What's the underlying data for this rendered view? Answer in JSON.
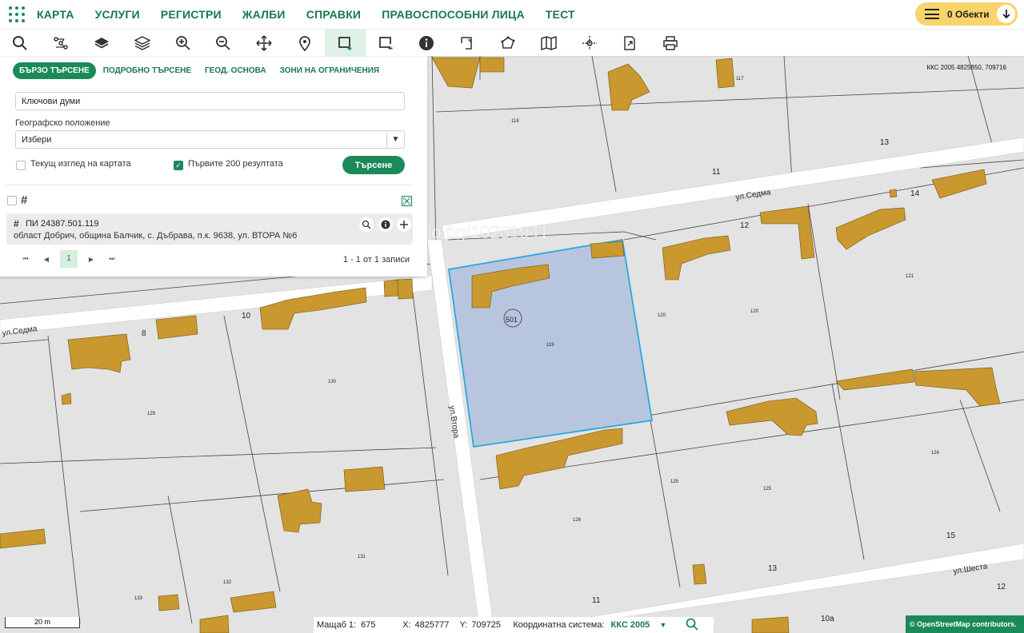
{
  "nav": {
    "items": [
      "КАРТА",
      "УСЛУГИ",
      "РЕГИСТРИ",
      "ЖАЛБИ",
      "СПРАВКИ",
      "ПРАВОСПОСОБНИ ЛИЦА",
      "ТЕСТ"
    ],
    "objects_label": "0 Обекти"
  },
  "toolbar": {
    "tools": [
      "search-icon",
      "route-icon",
      "layer-icon",
      "layers-icon",
      "zoom-in-icon",
      "zoom-out-icon",
      "pan-icon",
      "location-pin-icon",
      "select-rectangle-icon",
      "deselect-rectangle-icon",
      "info-icon",
      "measure-area-icon",
      "polygon-icon",
      "map-icon",
      "coordinate-icon",
      "export-icon",
      "print-icon"
    ],
    "active_index": 8
  },
  "panel": {
    "tabs": [
      "БЪРЗО ТЪРСЕНЕ",
      "ПОДРОБНО ТЪРСЕНЕ",
      "ГЕОД. ОСНОВА",
      "ЗОНИ НА ОГРАНИЧЕНИЯ"
    ],
    "keywords_placeholder": "Ключови думи",
    "geo_label": "Географско положение",
    "geo_value": "Избери",
    "current_view_label": "Текущ изглед на картата",
    "current_view_checked": false,
    "first200_label": "Първите 200 резултата",
    "first200_checked": true,
    "search_button": "Търсене",
    "result": {
      "title": "ПИ 24387.501.119",
      "address": "област Добрич, община Балчик, с. Дъбрава, п.к. 9638, ул. ВТОРА №6"
    },
    "pager": {
      "first": "⏮",
      "prev": "◀",
      "current": "1",
      "next": "▶",
      "last": "⏭"
    },
    "count": "1 - 1 от 1 записи"
  },
  "map": {
    "crs_readout": "ККС 2005 4825850, 709716",
    "watermark": "alo.bg/10231941",
    "streets": [
      "ул.Седма",
      "ул.Седма",
      "ул.Втора",
      "ул.Шеста"
    ],
    "numbers": [
      "13",
      "11",
      "14",
      "12",
      "10",
      "8",
      "13",
      "11",
      "15",
      "12",
      "10а"
    ],
    "parcels": [
      "118",
      "117",
      "119",
      "120",
      "120",
      "121",
      "130",
      "129",
      "125",
      "125",
      "124",
      "126",
      "131",
      "132",
      "133"
    ],
    "highlight_label": "501",
    "colors": {
      "building": "#c9982e",
      "highlight_fill": "#b7c6de",
      "highlight_stroke": "#29a8e0",
      "road": "#ffffff",
      "land": "#e3e3e3"
    }
  },
  "bottom": {
    "scale_bar": "20 m",
    "scale_label": "Мащаб 1:",
    "scale_value": "675",
    "x_label": "X:",
    "x_value": "4825777",
    "y_label": "Y:",
    "y_value": "709725",
    "crs_label": "Координатна система:",
    "crs_value": "ККС 2005",
    "osm": "© OpenStreetMap contributors."
  }
}
